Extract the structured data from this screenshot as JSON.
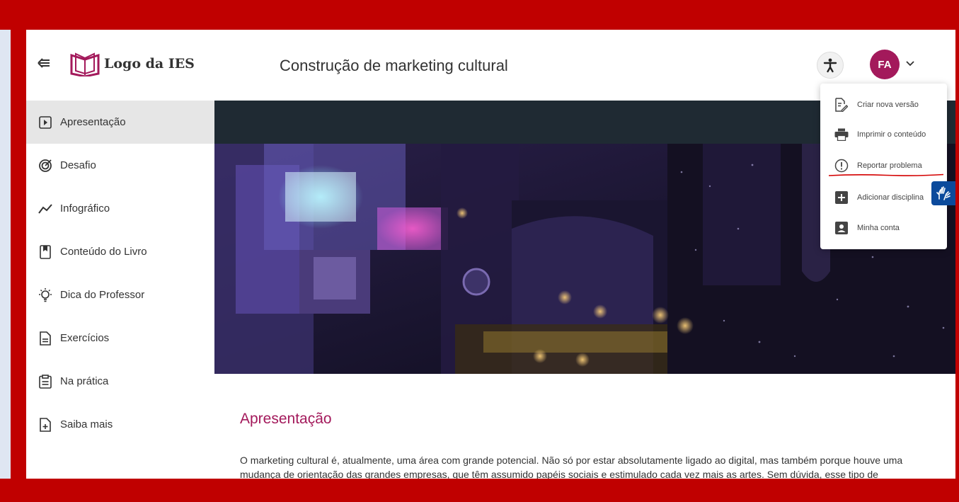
{
  "header": {
    "logo_text": "Logo da IES",
    "title": "Construção de marketing cultural",
    "avatar_initials": "FA"
  },
  "sidebar": {
    "items": [
      {
        "label": "Apresentação",
        "icon": "play-box-icon"
      },
      {
        "label": "Desafio",
        "icon": "target-icon"
      },
      {
        "label": "Infográfico",
        "icon": "trend-line-icon"
      },
      {
        "label": "Conteúdo do Livro",
        "icon": "bookmark-book-icon"
      },
      {
        "label": "Dica do Professor",
        "icon": "lightbulb-icon"
      },
      {
        "label": "Exercícios",
        "icon": "document-icon"
      },
      {
        "label": "Na prática",
        "icon": "clipboard-icon"
      },
      {
        "label": "Saiba mais",
        "icon": "document-plus-icon"
      }
    ],
    "active_index": 0
  },
  "menu": {
    "items": [
      {
        "label": "Criar nova versão",
        "icon": "edit-document-icon"
      },
      {
        "label": "Imprimir o conteúdo",
        "icon": "printer-icon"
      },
      {
        "label": "Reportar problema",
        "icon": "alert-circle-icon"
      },
      {
        "label": "Adicionar disciplina",
        "icon": "plus-square-icon"
      },
      {
        "label": "Minha conta",
        "icon": "account-icon"
      }
    ]
  },
  "content": {
    "section_title": "Apresentação",
    "paragraph": "O marketing cultural é, atualmente, uma área com grande potencial. Não só por estar absolutamente ligado ao digital, mas também porque houve uma mudança de orientação das grandes empresas, que têm assumido papéis sociais e estimulado cada vez mais as artes. Sem dúvida, esse tipo de"
  },
  "colors": {
    "accent": "#a3195b",
    "frame": "#c00000",
    "hero_band": "#1f2a33",
    "libras": "#0b4a9c"
  }
}
